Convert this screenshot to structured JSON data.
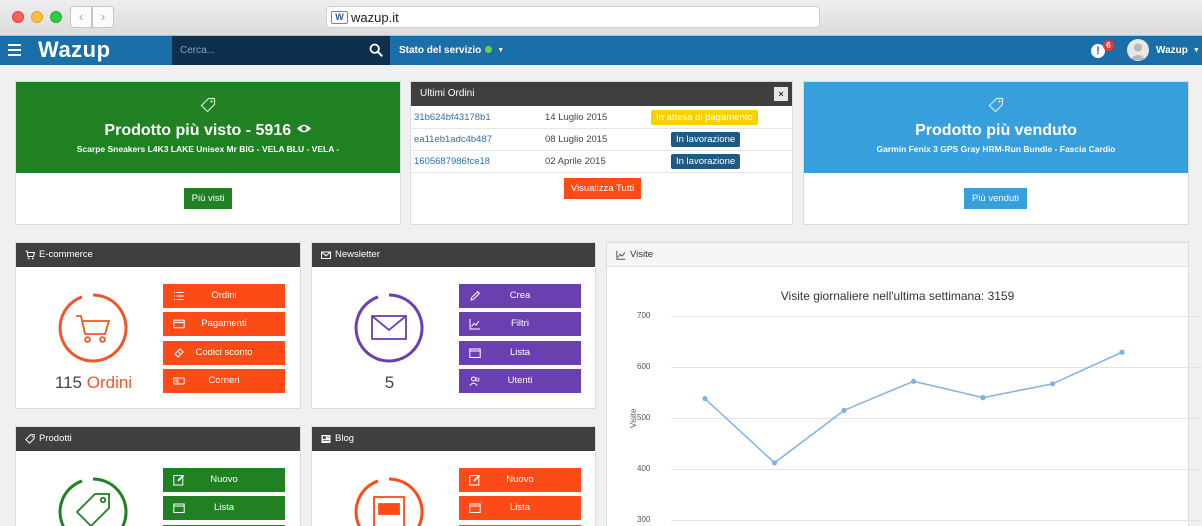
{
  "browser": {
    "url": "wazup.it",
    "favicon_text": "W"
  },
  "appbar": {
    "logo": "Wazup",
    "search_placeholder": "Cerca...",
    "service_status": "Stato del servizio",
    "notification_count": "6",
    "username": "Wazup"
  },
  "top_cards": {
    "most_viewed": {
      "title": "Prodotto più visto - 5916",
      "subtitle": "Scarpe Sneakers L4K3 LAKE Unisex Mr BIG - VELA BLU - VELA -",
      "button": "Più visti"
    },
    "orders": {
      "title": "Ultimi Ordini",
      "close": "×",
      "rows": [
        {
          "id": "31b624bf43178b1",
          "date": "14 Luglio 2015",
          "status": "In attesa di pagamento"
        },
        {
          "id": "ea11eb1adc4b487",
          "date": "08 Luglio 2015",
          "status": "In lavorazione"
        },
        {
          "id": "1605687986fce18",
          "date": "02 Aprile 2015",
          "status": "In lavorazione"
        }
      ],
      "button": "Visualizza Tutti"
    },
    "best_seller": {
      "title": "Prodotto più venduto",
      "subtitle": "Garmin Fenix 3 GPS Gray HRM-Run Bundle - Fascia Cardio",
      "button": "Più venduti"
    }
  },
  "ecommerce": {
    "title": "E-commerce",
    "count": "115",
    "count_unit": "Ordini",
    "buttons": [
      "Ordini",
      "Pagamenti",
      "Codici sconto",
      "Corrieri"
    ]
  },
  "newsletter": {
    "title": "Newsletter",
    "count": "5",
    "buttons": [
      "Crea",
      "Filtri",
      "Lista",
      "Utenti"
    ]
  },
  "prodotti": {
    "title": "Prodotti",
    "buttons": [
      "Nuovo",
      "Lista"
    ]
  },
  "blog": {
    "title": "Blog",
    "buttons": [
      "Nuovo",
      "Lista"
    ]
  },
  "visite": {
    "title": "Visite"
  },
  "colors": {
    "brand_blue": "#1b6fa8",
    "green": "#1f8122",
    "light_blue": "#389fdd",
    "orange": "#fd4b17",
    "purple": "#6a3fb0"
  },
  "chart_data": {
    "type": "line",
    "title": "Visite giornaliere nell'ultima settimana: 3159",
    "ylabel": "Visite",
    "xlabel": "",
    "ylim": [
      300,
      700
    ],
    "yticks": [
      "700",
      "600",
      "500",
      "400",
      "300"
    ],
    "series": [
      {
        "values": [
          538,
          412,
          515,
          572,
          540,
          567,
          629
        ]
      }
    ]
  }
}
